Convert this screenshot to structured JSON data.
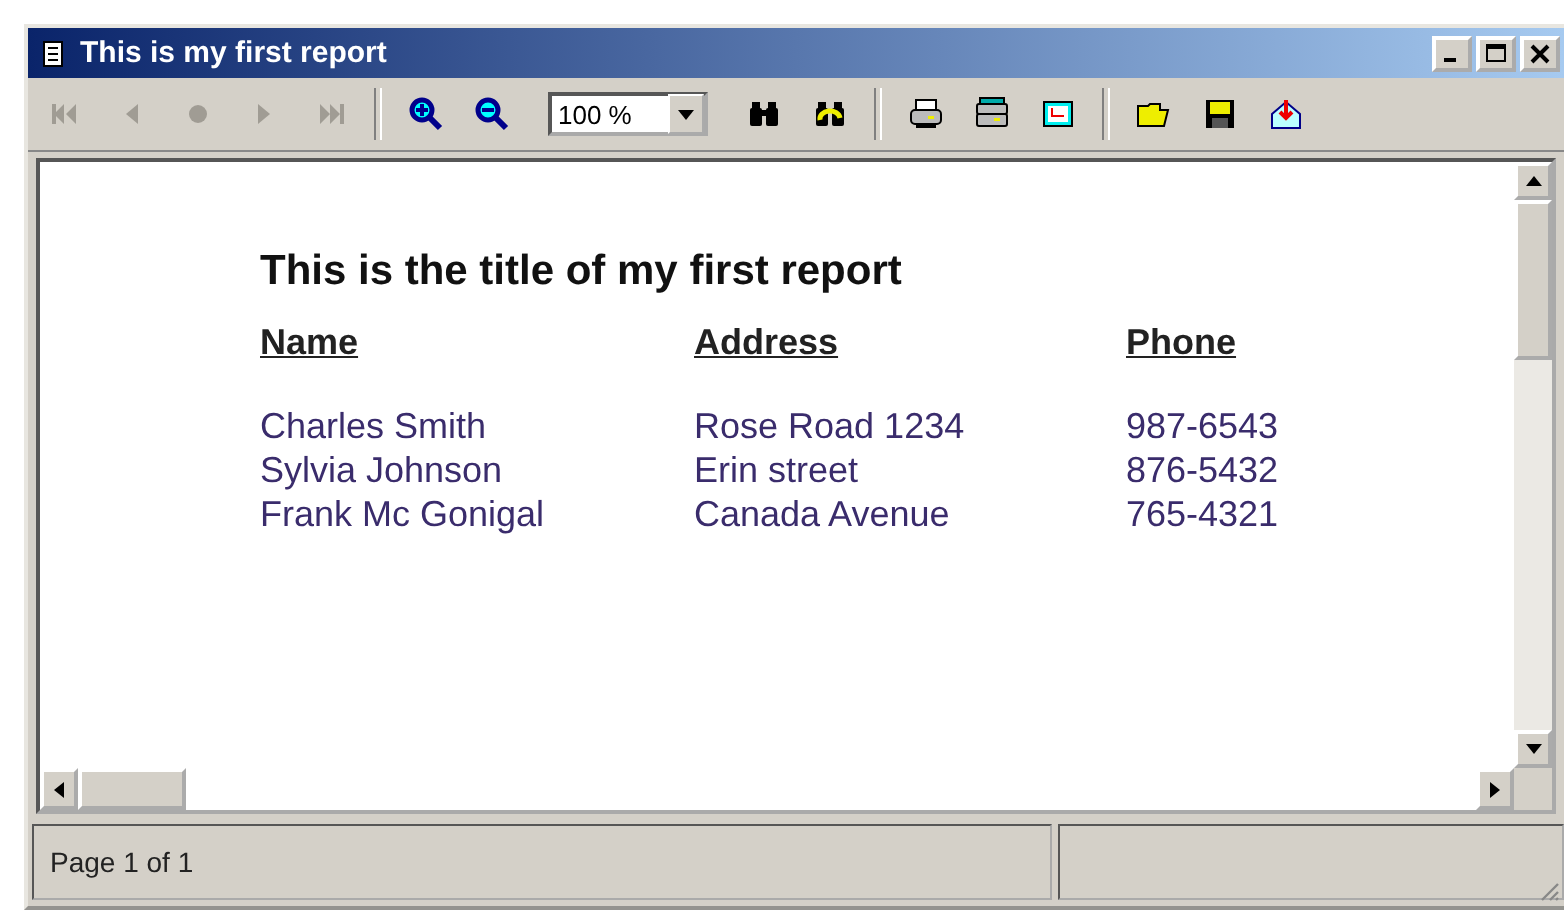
{
  "window": {
    "title": "This is my first report"
  },
  "toolbar": {
    "navigation": [
      {
        "kind": "first",
        "disabled": true
      },
      {
        "kind": "previous",
        "disabled": true
      },
      {
        "kind": "stop",
        "disabled": true
      },
      {
        "kind": "next",
        "disabled": true
      },
      {
        "kind": "last",
        "disabled": true
      }
    ],
    "zoom": {
      "value": "100 %"
    }
  },
  "report": {
    "title": "This is the title of my first report",
    "columns": [
      "Name",
      "Address",
      "Phone"
    ],
    "rows": [
      [
        "Charles Smith",
        "Rose Road 1234",
        "987-6543"
      ],
      [
        "Sylvia Johnson",
        "Erin street",
        "876-5432"
      ],
      [
        "Frank Mc Gonigal",
        "Canada Avenue",
        "765-4321"
      ]
    ]
  },
  "status_bar": {
    "page": "Page 1 of 1"
  }
}
